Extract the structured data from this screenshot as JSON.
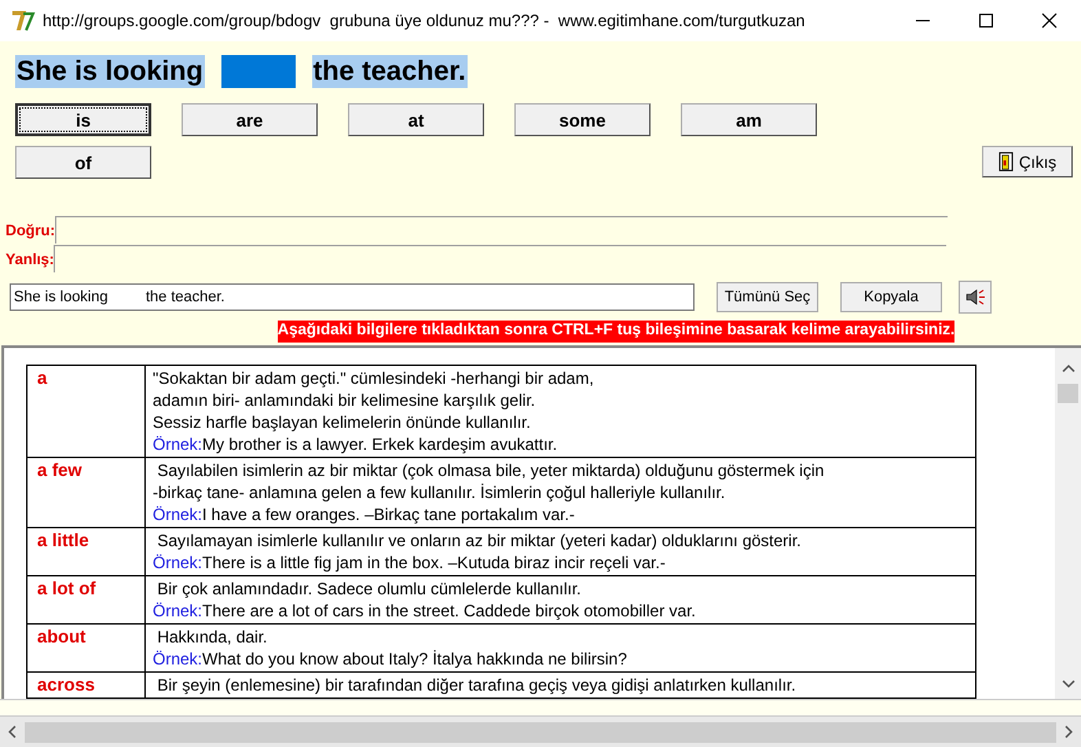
{
  "window": {
    "title": "http://groups.google.com/group/bdogv  grubuna üye oldunuz mu??? -  www.egitimhane.com/turgutkuzan"
  },
  "sentence": {
    "before": "She is looking",
    "after": "the teacher."
  },
  "options": [
    {
      "label": "is",
      "focused": true
    },
    {
      "label": "are",
      "focused": false
    },
    {
      "label": "at",
      "focused": false
    },
    {
      "label": "some",
      "focused": false
    },
    {
      "label": "am",
      "focused": false
    },
    {
      "label": "of",
      "focused": false
    }
  ],
  "exit_button": "Çıkış",
  "answers": [
    {
      "label": "Doğru:"
    },
    {
      "label": "Yanlış:"
    }
  ],
  "sentence_field": {
    "value": "She is looking         the teacher."
  },
  "actions": [
    "Tümünü Seç",
    "Kopyala"
  ],
  "notice": "Aşağıdaki bilgilere tıkladıktan sonra CTRL+F tuş bileşimine basarak kelime arayabilirsiniz.",
  "dictionary": [
    {
      "word": "a",
      "lines": [
        {
          "text": "\"Sokaktan bir adam geçti.\" cümlesindeki -herhangi bir adam,"
        },
        {
          "text": "adamın biri- anlamındaki bir kelimesine karşılık gelir."
        },
        {
          "text": "Sessiz harfle başlayan kelimelerin önünde kullanılır."
        },
        {
          "label": "Örnek:",
          "text": "My brother is a lawyer. Erkek kardeşim avukattır."
        }
      ]
    },
    {
      "word": "a few",
      "lines": [
        {
          "text": " Sayılabilen isimlerin az bir miktar (çok olmasa bile, yeter miktarda) olduğunu göstermek için"
        },
        {
          "text": "-birkaç tane- anlamına gelen a few kullanılır. İsimlerin çoğul halleriyle kullanılır."
        },
        {
          "label": "Örnek:",
          "text": "I have a few oranges. –Birkaç tane portakalım var.-"
        }
      ]
    },
    {
      "word": "a little",
      "lines": [
        {
          "text": " Sayılamayan isimlerle kullanılır ve onların az bir miktar (yeteri kadar) olduklarını gösterir."
        },
        {
          "label": "Örnek:",
          "text": "There is a little fig jam in the box. –Kutuda biraz incir reçeli var.-"
        }
      ]
    },
    {
      "word": "a lot of",
      "lines": [
        {
          "text": " Bir çok anlamındadır. Sadece olumlu cümlelerde kullanılır."
        },
        {
          "label": "Örnek:",
          "text": "There are a lot of cars in the street. Caddede birçok otomobiller var."
        }
      ]
    },
    {
      "word": "about",
      "lines": [
        {
          "text": " Hakkında, dair."
        },
        {
          "label": "Örnek:",
          "text": "What do you know about Italy? İtalya hakkında ne bilirsin?"
        }
      ]
    },
    {
      "word": "across",
      "lines": [
        {
          "text": " Bir şeyin (enlemesine) bir tarafından diğer tarafına geçiş veya gidişi anlatırken kullanılır."
        }
      ]
    }
  ]
}
